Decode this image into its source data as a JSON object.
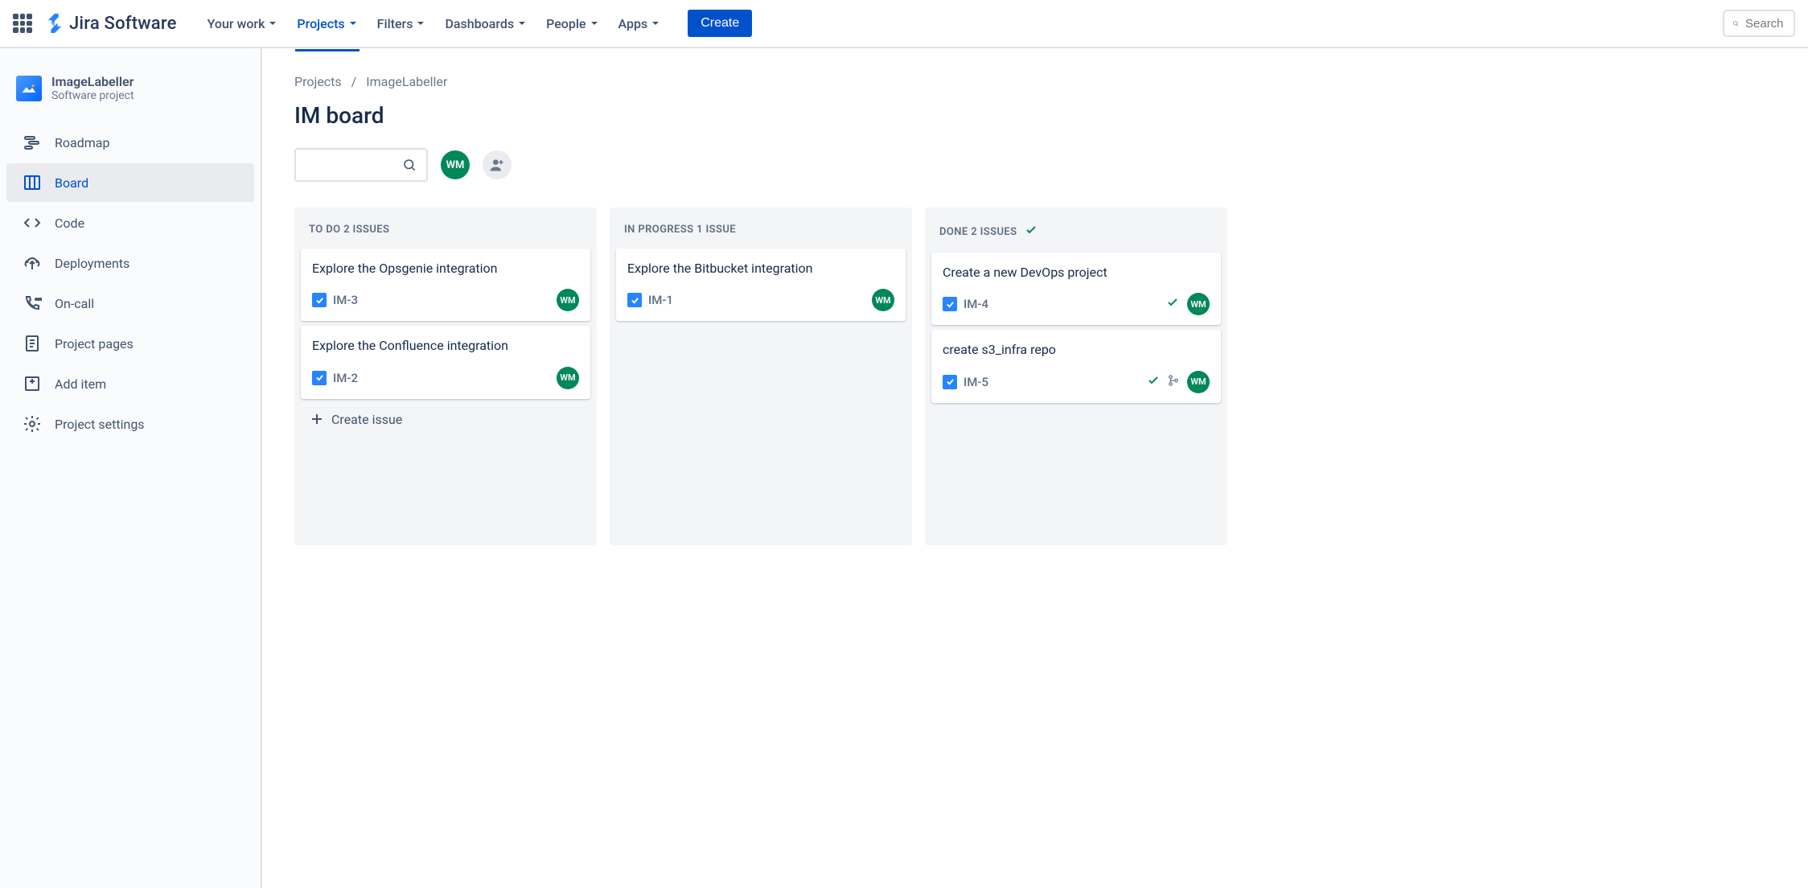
{
  "nav": {
    "product": "Jira Software",
    "items": [
      "Your work",
      "Projects",
      "Filters",
      "Dashboards",
      "People",
      "Apps"
    ],
    "active_index": 1,
    "create": "Create",
    "search_placeholder": "Search"
  },
  "sidebar": {
    "project_name": "ImageLabeller",
    "project_type": "Software project",
    "items": [
      {
        "label": "Roadmap",
        "icon": "roadmap"
      },
      {
        "label": "Board",
        "icon": "board",
        "active": true
      },
      {
        "label": "Code",
        "icon": "code"
      },
      {
        "label": "Deployments",
        "icon": "deployments"
      },
      {
        "label": "On-call",
        "icon": "oncall"
      },
      {
        "label": "Project pages",
        "icon": "pages"
      },
      {
        "label": "Add item",
        "icon": "add"
      },
      {
        "label": "Project settings",
        "icon": "settings"
      }
    ]
  },
  "breadcrumb": {
    "root": "Projects",
    "current": "ImageLabeller"
  },
  "page_title": "IM board",
  "avatar_initials": "WM",
  "columns": [
    {
      "title": "TO DO 2 ISSUES",
      "show_create": true,
      "cards": [
        {
          "title": "Explore the Opsgenie integration",
          "key": "IM-3",
          "assignee": "WM"
        },
        {
          "title": "Explore the Confluence integration",
          "key": "IM-2",
          "assignee": "WM"
        }
      ]
    },
    {
      "title": "IN PROGRESS 1 ISSUE",
      "cards": [
        {
          "title": "Explore the Bitbucket integration",
          "key": "IM-1",
          "assignee": "WM"
        }
      ]
    },
    {
      "title": "DONE 2 ISSUES",
      "done": true,
      "cards": [
        {
          "title": "Create a new DevOps project",
          "key": "IM-4",
          "assignee": "WM",
          "done": true
        },
        {
          "title": "create s3_infra repo",
          "key": "IM-5",
          "assignee": "WM",
          "done": true,
          "branch": true
        }
      ]
    }
  ],
  "create_issue_label": "Create issue"
}
